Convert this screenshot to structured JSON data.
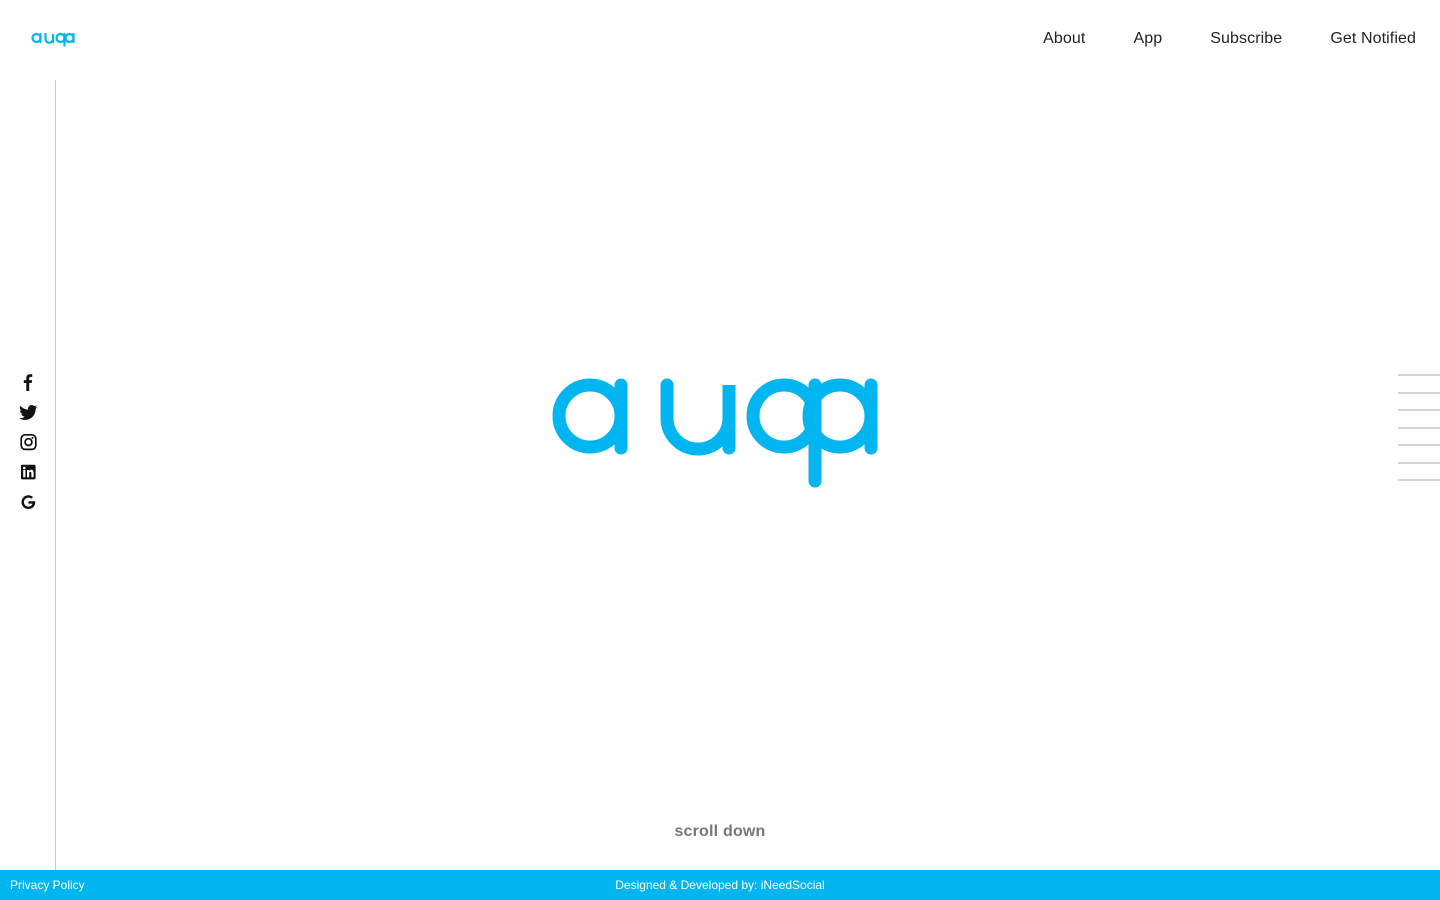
{
  "brand": {
    "name": "auqa",
    "color": "#00b5f0"
  },
  "nav": {
    "items": [
      {
        "label": "About"
      },
      {
        "label": "App"
      },
      {
        "label": "Subscribe"
      },
      {
        "label": "Get Notified"
      }
    ]
  },
  "social": [
    {
      "icon": "facebook-icon"
    },
    {
      "icon": "twitter-icon"
    },
    {
      "icon": "instagram-icon"
    },
    {
      "icon": "linkedin-icon"
    },
    {
      "icon": "google-icon"
    }
  ],
  "section_nav": {
    "count": 7,
    "color": "#d4d4d4"
  },
  "hero": {
    "scroll_label": "scroll down"
  },
  "footer": {
    "privacy_label": "Privacy Policy",
    "credit_label": "Designed & Developed by: iNeedSocial",
    "background": "#00b5f0"
  }
}
